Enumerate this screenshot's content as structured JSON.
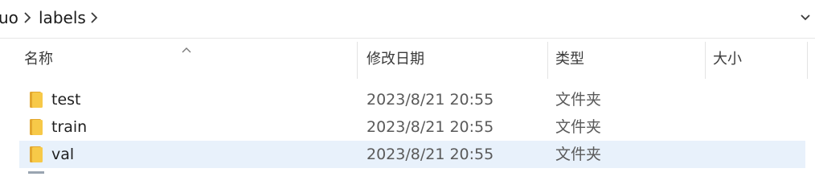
{
  "address_bar": {
    "crumbs": [
      "uo",
      "labels"
    ],
    "dropdown_icon": "chevron-down-icon"
  },
  "columns": {
    "name": "名称",
    "date": "修改日期",
    "type": "类型",
    "size": "大小",
    "sorted_by": "name",
    "sort_icon": "sort-ascending-icon"
  },
  "rows": [
    {
      "name": "test",
      "date": "2023/8/21 20:55",
      "type": "文件夹",
      "size": "",
      "icon": "folder-icon",
      "selected": false
    },
    {
      "name": "train",
      "date": "2023/8/21 20:55",
      "type": "文件夹",
      "size": "",
      "icon": "folder-icon",
      "selected": false
    },
    {
      "name": "val",
      "date": "2023/8/21 20:55",
      "type": "文件夹",
      "size": "",
      "icon": "folder-icon",
      "selected": true
    }
  ],
  "colors": {
    "selection_background": "#e8f1fb",
    "folder_fill": "#f7c948",
    "folder_shade": "#e3a72f"
  }
}
